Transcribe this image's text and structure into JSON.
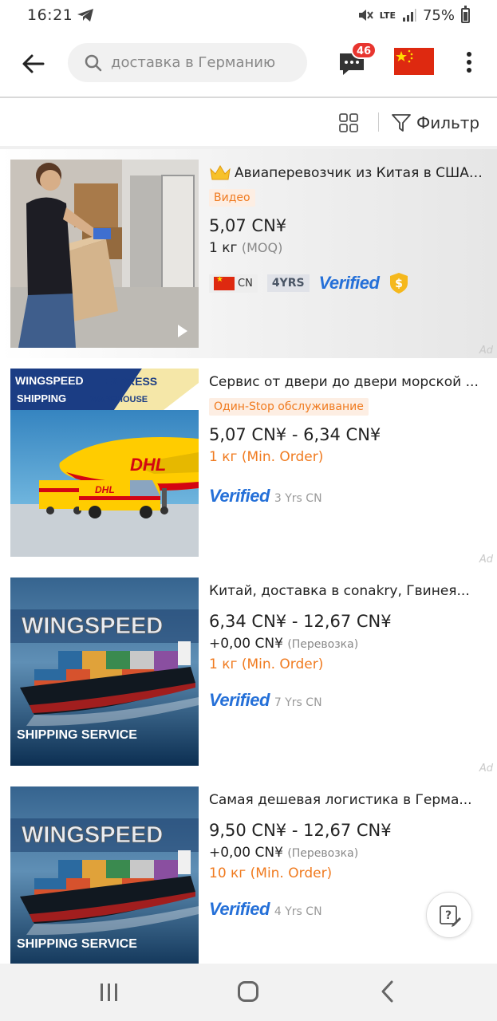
{
  "status_bar": {
    "time": "16:21",
    "battery": "75%",
    "network": "LTE"
  },
  "header": {
    "search_text": "доставка в Германию",
    "messages_badge": "46"
  },
  "filter_bar": {
    "filter_label": "Фильтр"
  },
  "products": [
    {
      "title": "Авиаперевозчик из Китая в США/...",
      "tag": "Видео",
      "price": "5,07 CN¥",
      "moq_value": "1 кг",
      "moq_note": "(MOQ)",
      "country": "CN",
      "years_badge": "4YRS",
      "verified": "Verified",
      "ad": "Ad"
    },
    {
      "title": "Сервис от двери до двери морской ...",
      "tag": "Один-Stop обслуживание",
      "price": "5,07 CN¥ - 6,34 CN¥",
      "moq": "1 кг (Min. Order)",
      "verified": "Verified",
      "years_text": "3 Yrs CN",
      "ad": "Ad",
      "thumb_text": {
        "brand_top": "WINGSPEED",
        "brand_bottom": "SHIPPING",
        "express": "EXPRESS",
        "warehouse": "WAREHOUSE",
        "plane_logo": "DHL",
        "van_logo": "DHL"
      }
    },
    {
      "title": "Китай, доставка в conakry, Гвинея...",
      "price": "6,34 CN¥ - 12,67 CN¥",
      "shipping": "+0,00 CN¥",
      "shipping_note": "(Перевозка)",
      "moq": "1 кг (Min. Order)",
      "verified": "Verified",
      "years_text": "7 Yrs CN",
      "ad": "Ad",
      "thumb_text": {
        "brand": "WINGSPEED",
        "service": "SHIPPING SERVICE"
      }
    },
    {
      "title": "Самая дешевая логистика в Герма...",
      "price": "9,50 CN¥ - 12,67 CN¥",
      "shipping": "+0,00 CN¥",
      "shipping_note": "(Перевозка)",
      "moq": "10 кг (Min. Order)",
      "verified": "Verified",
      "years_text": "4 Yrs CN",
      "thumb_text": {
        "brand": "WINGSPEED",
        "service": "SHIPPING SERVICE"
      }
    }
  ],
  "colors": {
    "accent_orange": "#f07b20",
    "verified_blue": "#2570d8",
    "badge_red": "#e8352f"
  }
}
